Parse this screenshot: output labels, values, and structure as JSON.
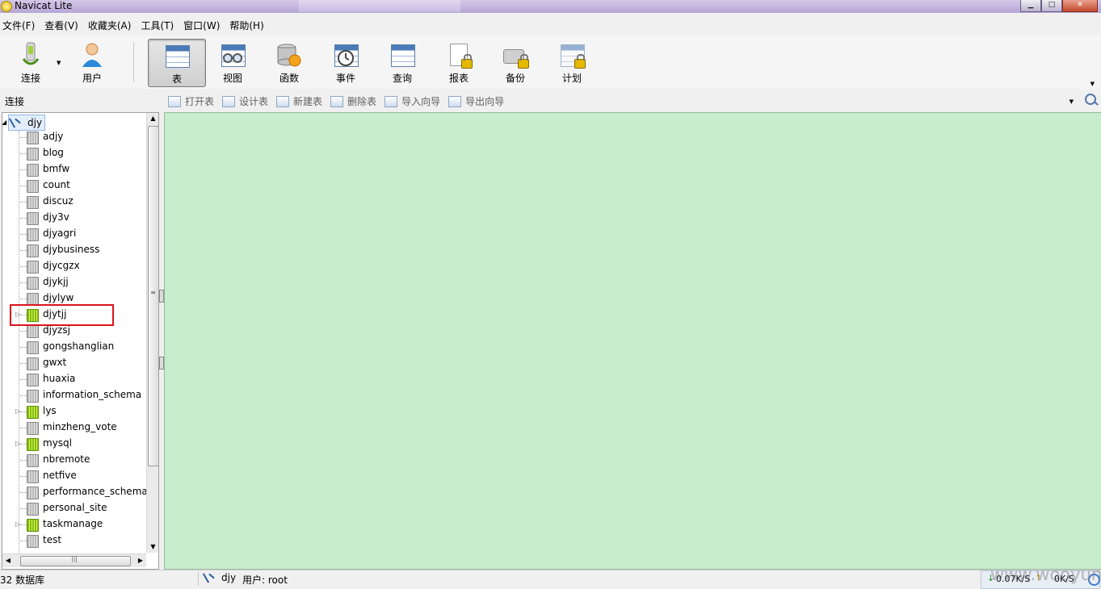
{
  "window": {
    "title": "Navicat Lite"
  },
  "menu": [
    "文件(F)",
    "查看(V)",
    "收藏夹(A)",
    "工具(T)",
    "窗口(W)",
    "帮助(H)"
  ],
  "toolbar": {
    "connect": "连接",
    "user": "用户",
    "buttons": [
      "表",
      "视图",
      "函数",
      "事件",
      "查询",
      "报表",
      "备份",
      "计划"
    ]
  },
  "panel": {
    "connections_label": "连接"
  },
  "object_actions": [
    "打开表",
    "设计表",
    "新建表",
    "删除表",
    "导入向导",
    "导出向导"
  ],
  "tree": {
    "connection": "djy",
    "databases": [
      {
        "name": "adjy",
        "open": false
      },
      {
        "name": "blog",
        "open": false
      },
      {
        "name": "bmfw",
        "open": false
      },
      {
        "name": "count",
        "open": false
      },
      {
        "name": "discuz",
        "open": false
      },
      {
        "name": "djy3v",
        "open": false
      },
      {
        "name": "djyagri",
        "open": false
      },
      {
        "name": "djybusiness",
        "open": false
      },
      {
        "name": "djycgzx",
        "open": false
      },
      {
        "name": "djykjj",
        "open": false
      },
      {
        "name": "djylyw",
        "open": false
      },
      {
        "name": "djytjj",
        "open": true
      },
      {
        "name": "djyzsj",
        "open": false
      },
      {
        "name": "gongshanglian",
        "open": false
      },
      {
        "name": "gwxt",
        "open": false
      },
      {
        "name": "huaxia",
        "open": false
      },
      {
        "name": "information_schema",
        "open": false
      },
      {
        "name": "lys",
        "open": true
      },
      {
        "name": "minzheng_vote",
        "open": false
      },
      {
        "name": "mysql",
        "open": true
      },
      {
        "name": "nbremote",
        "open": false
      },
      {
        "name": "netfive",
        "open": false
      },
      {
        "name": "performance_schema",
        "open": false
      },
      {
        "name": "personal_site",
        "open": false
      },
      {
        "name": "taskmanage",
        "open": true
      },
      {
        "name": "test",
        "open": false
      }
    ]
  },
  "status": {
    "db_count": "32 数据库",
    "connection": "djy",
    "user": "用户: root",
    "download": "0.07K/S",
    "upload": "0K/S"
  },
  "watermark": "www.wooyun.org"
}
